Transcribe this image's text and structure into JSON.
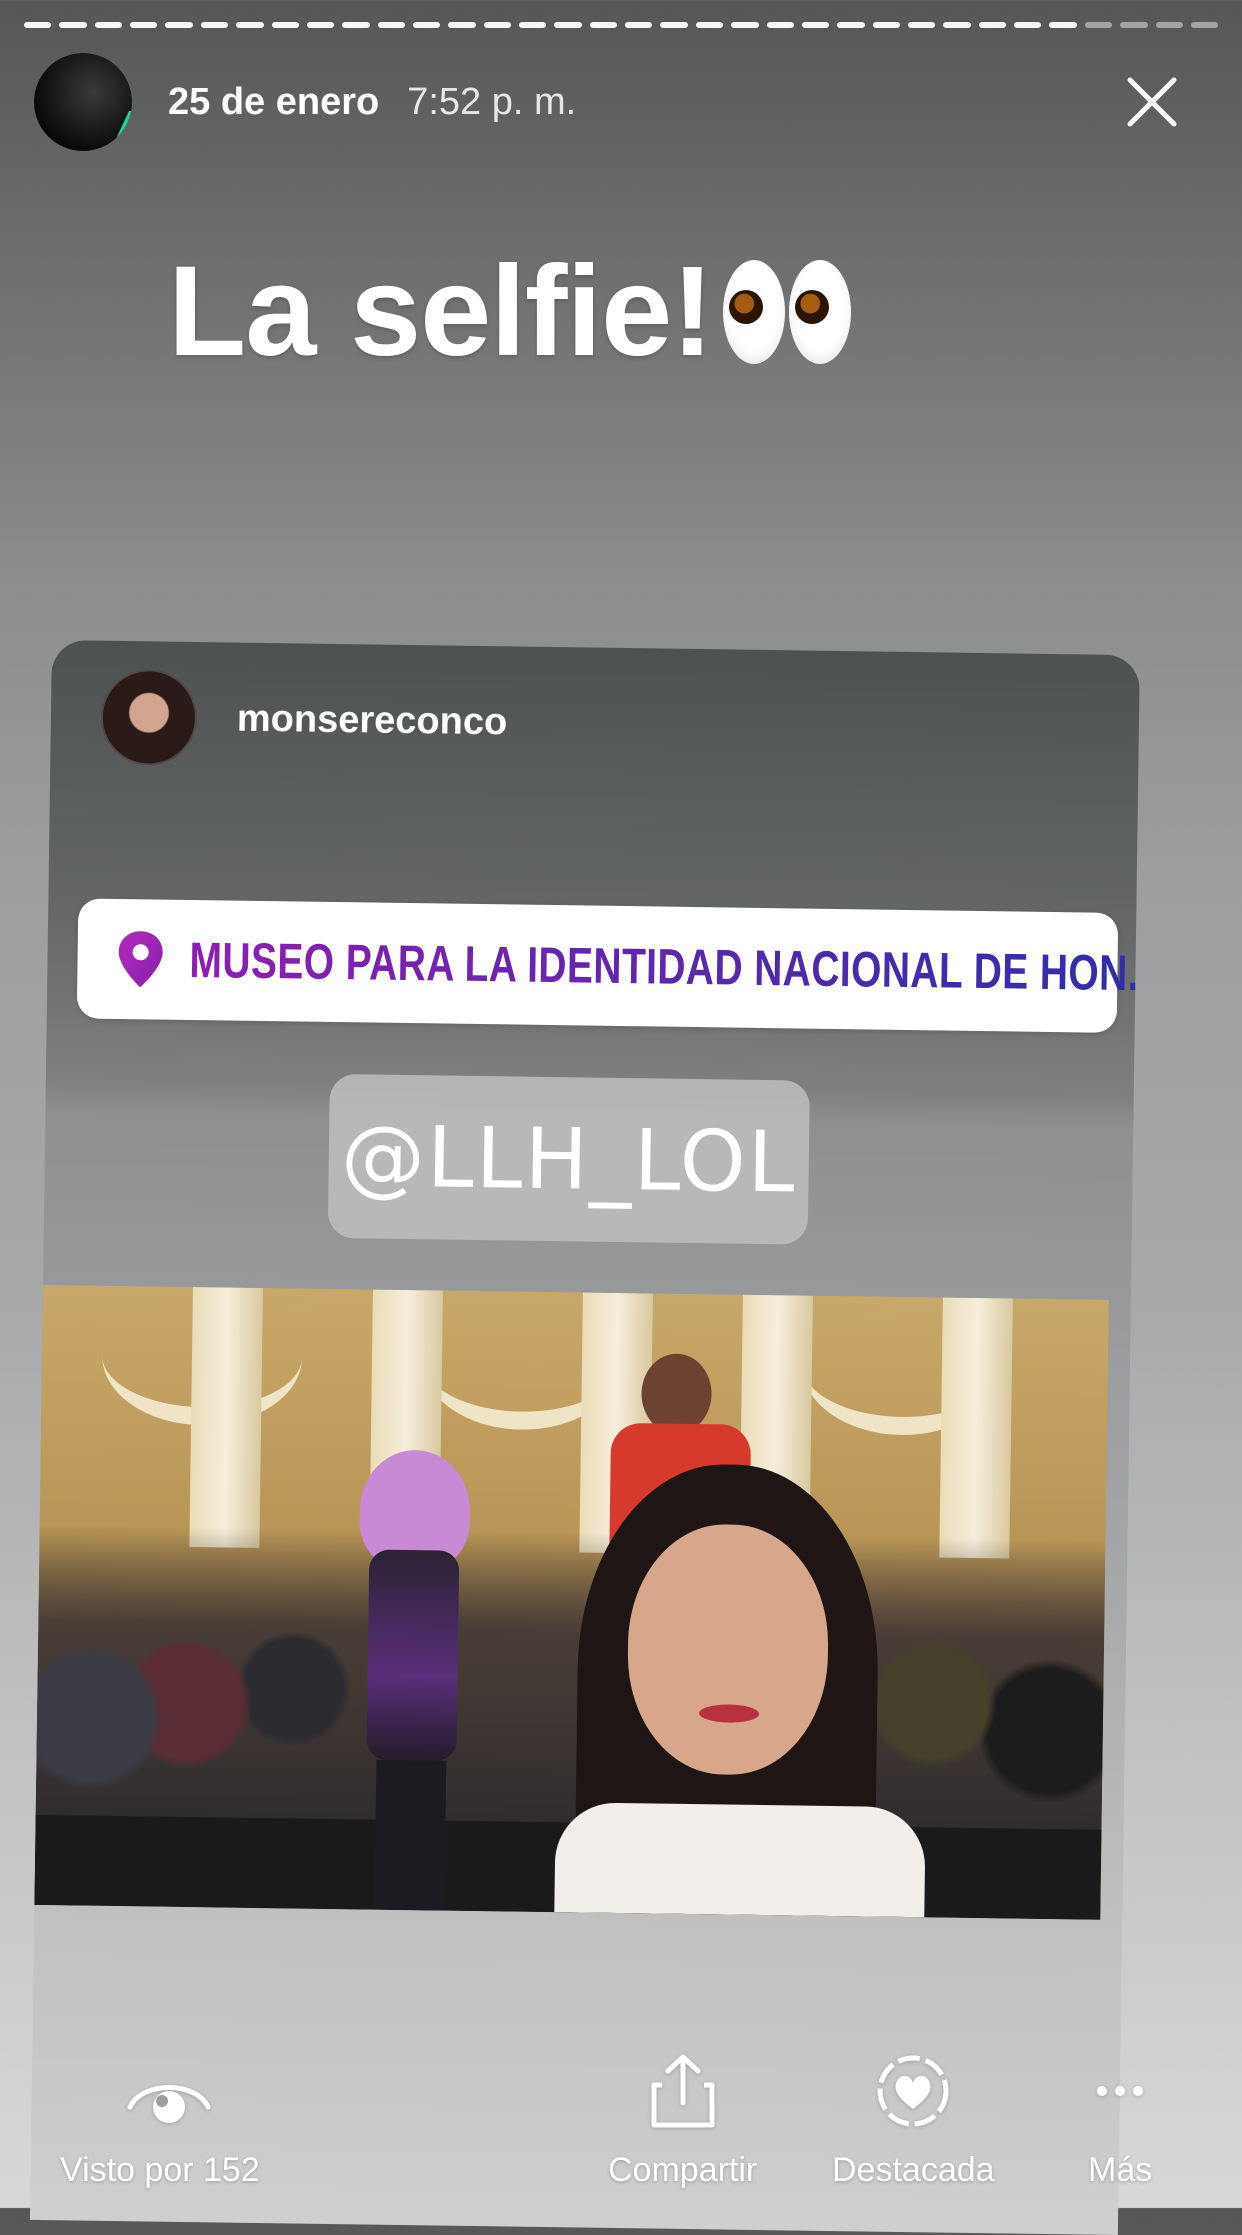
{
  "story": {
    "progress_segments": [
      1,
      1,
      1,
      1,
      1,
      1,
      1,
      1,
      1,
      1,
      1,
      1,
      1,
      1,
      1,
      1,
      1,
      1,
      1,
      1,
      1,
      1,
      1,
      1,
      1,
      1,
      1,
      1,
      1,
      1,
      0,
      0,
      0,
      0
    ],
    "date": "25 de enero",
    "time": "7:52 p. m."
  },
  "caption": {
    "text": "La selfie!",
    "emoji": "eyes-icon"
  },
  "shared_post": {
    "username": "monsereconco",
    "location": "MUSEO PARA LA IDENTIDAD NACIONAL DE HON...",
    "mention": "@LLH_LOL"
  },
  "actions": {
    "views": "Visto por 152",
    "share": "Compartir",
    "highlight": "Destacada",
    "more": "Más"
  },
  "colors": {
    "location_gradient_start": "#8b1fb3",
    "location_gradient_end": "#2b2fa8"
  }
}
